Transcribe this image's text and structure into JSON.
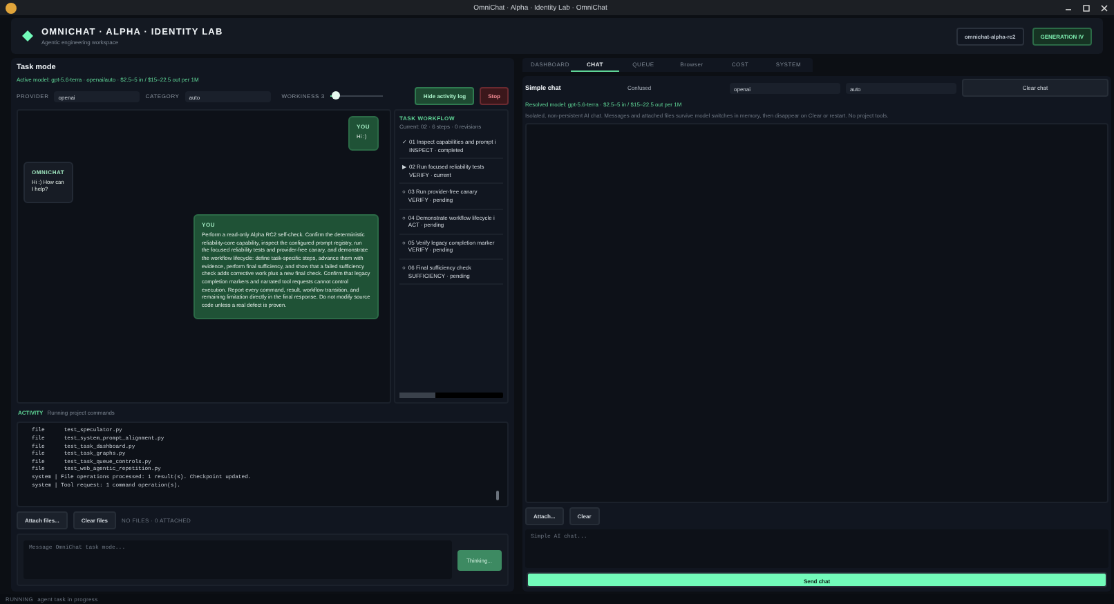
{
  "window": {
    "title": "OmniChat · Alpha · Identity Lab · OmniChat"
  },
  "header": {
    "title": "OMNICHAT · ALPHA · IDENTITY LAB",
    "subtitle": "Agentic engineering workspace",
    "version": "omnichat-alpha-rc2",
    "generation": "GENERATION IV"
  },
  "task": {
    "title": "Task mode",
    "model_line": "Active model: gpt-5.6-terra · openai/auto · $2.5–5 in / $15–22.5 out per 1M",
    "fields": [
      {
        "label": "PROVIDER",
        "value": "openai"
      },
      {
        "label": "CATEGORY",
        "value": "auto"
      }
    ],
    "slider": {
      "label": "WORKINESS 3",
      "level": 0.12
    },
    "buttons": [
      {
        "label": "Hide activity log",
        "kind": "primary"
      },
      {
        "label": "Stop",
        "kind": "danger"
      }
    ],
    "messages": [
      {
        "sender": "YOU",
        "text": "Hi :)",
        "kind": "user"
      },
      {
        "sender": "OMNICHAT",
        "text": "Hi :) How can I help?",
        "kind": "assistant"
      },
      {
        "sender": "YOU",
        "text": "Perform a read-only Alpha RC2 self-check. Confirm the deterministic reliability-core capability, inspect the configured prompt registry, run the focused reliability tests and provider-free canary, and demonstrate the workflow lifecycle: define task-specific steps, advance them with evidence, perform final sufficiency, and show that a failed sufficiency check adds corrective work plus a new final check. Confirm that legacy completion markers and narrated tool requests cannot control execution. Report every command, result, workflow transition, and remaining limitation directly in the final response. Do not modify source code unless a real defect is proven.",
        "kind": "user"
      }
    ],
    "workflow": {
      "title": "TASK WORKFLOW",
      "summary": "Current: 02 · 6 steps · 0 revisions",
      "steps": [
        {
          "marker": "✓",
          "text": "01 Inspect capabilities and prompt i",
          "sub": "INSPECT · completed"
        },
        {
          "marker": "▶",
          "text": "02 Run focused reliability tests",
          "sub": "VERIFY · current"
        },
        {
          "marker": "○",
          "text": "03 Run provider-free canary",
          "sub": "VERIFY · pending"
        },
        {
          "marker": "○",
          "text": "04 Demonstrate workflow lifecycle i",
          "sub": "ACT · pending"
        },
        {
          "marker": "○",
          "text": "05 Verify legacy completion marker",
          "sub": "VERIFY · pending"
        },
        {
          "marker": "○",
          "text": "06 Final sufficiency check",
          "sub": "SUFFICIENCY · pending"
        }
      ]
    },
    "activity": {
      "label": "ACTIVITY",
      "text": "Running project commands"
    },
    "log": [
      "file      test_speculator.py",
      "file      test_system_prompt_alignment.py",
      "file      test_task_dashboard.py",
      "file      test_task_graphs.py",
      "file      test_task_queue_controls.py",
      "file      test_web_agentic_repetition.py",
      "system | File operations processed: 1 result(s). Checkpoint updated.",
      "system | Tool request: 1 command operation(s)."
    ],
    "file_buttons": [
      "Attach files...",
      "Clear files"
    ],
    "files_note": "NO FILES · 0 ATTACHED",
    "composer": {
      "placeholder": "Message OmniChat task mode...",
      "send": "Thinking...",
      "disabled": true
    }
  },
  "chat": {
    "tabs": [
      {
        "label": "DASHBOARD",
        "selected": false
      },
      {
        "label": "CHAT",
        "selected": true
      },
      {
        "label": "QUEUE",
        "selected": false
      },
      {
        "label": "Browser",
        "selected": false
      },
      {
        "label": "COST",
        "selected": false
      },
      {
        "label": "SYSTEM",
        "selected": false
      }
    ],
    "title": "Simple chat",
    "mode": "Confused",
    "provider": "openai",
    "category": "auto",
    "clear": "Clear chat",
    "resolved": "Resolved model: gpt-5.6-terra · $2.5–5 in / $15–22.5 out per 1M",
    "note": "Isolated, non-persistent AI chat. Messages and attached files survive model switches in memory, then disappear on Clear or restart. No project tools.",
    "buttons": [
      "Attach...",
      "Clear"
    ],
    "placeholder": "Simple AI chat...",
    "send": "Send chat"
  },
  "status": {
    "state": "RUNNING",
    "text": "agent task in progress"
  }
}
